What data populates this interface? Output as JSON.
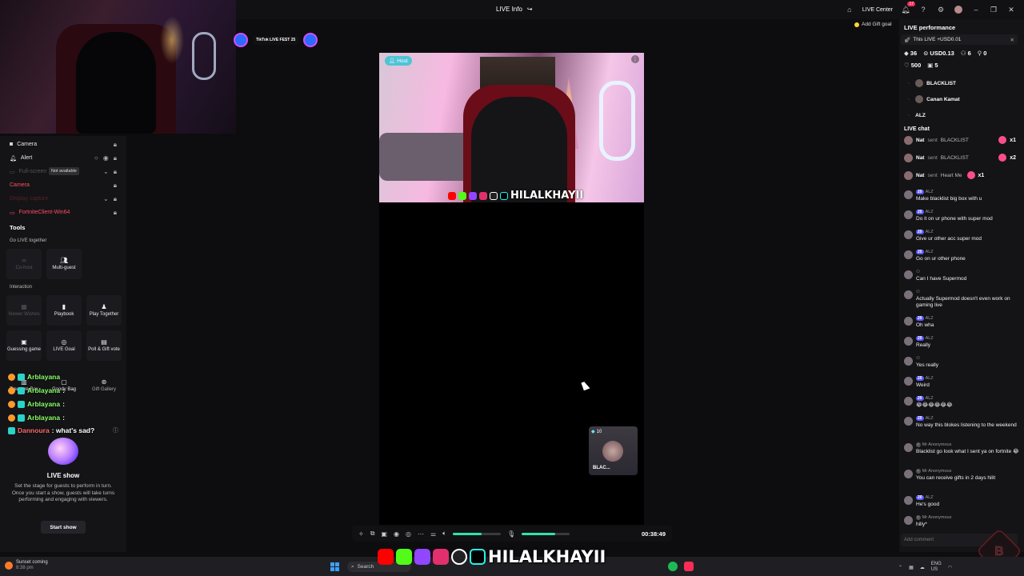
{
  "titlebar": {
    "live_info": "LIVE Info",
    "live_center": "LIVE Center",
    "notif_count": "17",
    "add_gift_goal": "Add Gift goal"
  },
  "overlay": {
    "livefest": "TikTok LIVE FEST 25"
  },
  "sources": [
    {
      "label": "Camera"
    },
    {
      "label": "Alert"
    },
    {
      "label": "Full-screen"
    },
    {
      "label": "Camera"
    },
    {
      "label": "Display capture"
    },
    {
      "label": "FortniteClient-Win64"
    }
  ],
  "tooltip": "Not available",
  "tools": {
    "title": "Tools",
    "go_live_together": "Go LIVE together",
    "cohost": "Co-host",
    "multiguest": "Multi-guest",
    "interaction": "Interaction",
    "viewer_wishes": "Viewer Wishes",
    "playbook": "Playbook",
    "play_together": "Play Together",
    "guessing_game": "Guessing game",
    "live_goal": "LIVE Goal",
    "poll_gift_vote": "Poll & Gift vote",
    "treasure_box": "Treasure Box",
    "goody_bag": "Goody Bag",
    "gift_gallery": "Gift Gallery"
  },
  "overlay_chat": [
    {
      "name": "Arblayana",
      "text": ""
    },
    {
      "name": "Arblayana",
      "text": ":"
    },
    {
      "name": "Arblayana",
      "text": ":"
    },
    {
      "name": "Arblayana",
      "text": ":"
    },
    {
      "name": "Dannoura",
      "text": ": what's sad?"
    }
  ],
  "live_show": {
    "title": "LIVE show",
    "desc": "Set the stage for guests to perform in turn. Once you start a show, guests will take turns performing and engaging with viewers.",
    "button": "Start show"
  },
  "stage": {
    "host_badge": "Host",
    "host_name": "HILALKHAYII",
    "guest_count": "10",
    "guest_name": "BLAC..."
  },
  "controls": {
    "timer": "00:38:49",
    "volume": 0.6,
    "mic": 0.7
  },
  "performance": {
    "title": "LIVE performance",
    "this_live": "This LIVE +USD0.01",
    "diamonds": "36",
    "usd": "USD0.13",
    "viewers": "6",
    "shares": "0",
    "likes": "500",
    "gifts": "5",
    "top_viewers": [
      "BLACKLIST",
      "Canan Kamat",
      "ALZ"
    ]
  },
  "chat": {
    "title": "LIVE chat",
    "gifts": [
      {
        "user": "Nat",
        "sent": "sent",
        "item": "BLACKLIST",
        "count": "x1"
      },
      {
        "user": "Nat",
        "sent": "sent",
        "item": "BLACKLIST",
        "count": "x2"
      },
      {
        "user": "Nat",
        "sent": "sent",
        "item": "Heart Me",
        "count": "x1"
      }
    ],
    "messages": [
      {
        "user": "ALZ",
        "lvl": "20",
        "text": "Make blacklist big box with u"
      },
      {
        "user": "ALZ",
        "lvl": "20",
        "text": "Do it on ur phone with super mod"
      },
      {
        "user": "ALZ",
        "lvl": "20",
        "text": "Give ur other acc super mod"
      },
      {
        "user": "ALZ",
        "lvl": "20",
        "text": "Go on ur other phone"
      },
      {
        "user": "",
        "lvl": "",
        "text": "Can I have Supermod"
      },
      {
        "user": "",
        "lvl": "",
        "text": "Actually Supermod doesn't even work on gaming live"
      },
      {
        "user": "ALZ",
        "lvl": "20",
        "text": "Oh wha"
      },
      {
        "user": "ALZ",
        "lvl": "20",
        "text": "Really"
      },
      {
        "user": "",
        "lvl": "",
        "text": "Yes really"
      },
      {
        "user": "ALZ",
        "lvl": "20",
        "text": "Weird"
      },
      {
        "user": "ALZ",
        "lvl": "20",
        "text": "😂😂😂😂😂😂"
      },
      {
        "user": "ALZ",
        "lvl": "20",
        "text": "No way this blokes listening to the weekend"
      },
      {
        "user": "Mr Anonymous",
        "lvl": "",
        "text": "Blacklist go look what I sent ya on fortnite 😂"
      },
      {
        "user": "Mr Anonymous",
        "lvl": "",
        "text": "You can receive gifts in 2 days hilit"
      },
      {
        "user": "ALZ",
        "lvl": "20",
        "text": "He's good"
      },
      {
        "user": "Mr Anonymous",
        "lvl": "",
        "text": "hilly*"
      }
    ],
    "comment_placeholder": "Add comment"
  },
  "taskbar": {
    "weather_title": "Sunset coming",
    "weather_time": "8:38 pm",
    "search": "Search",
    "lang": "ENG",
    "region": "US",
    "banner_name": "HILALKHAYII"
  },
  "colors": {
    "accent": "#fe2c55",
    "slider": "#2ee5a3",
    "host_badge": "#4ec5d6"
  }
}
